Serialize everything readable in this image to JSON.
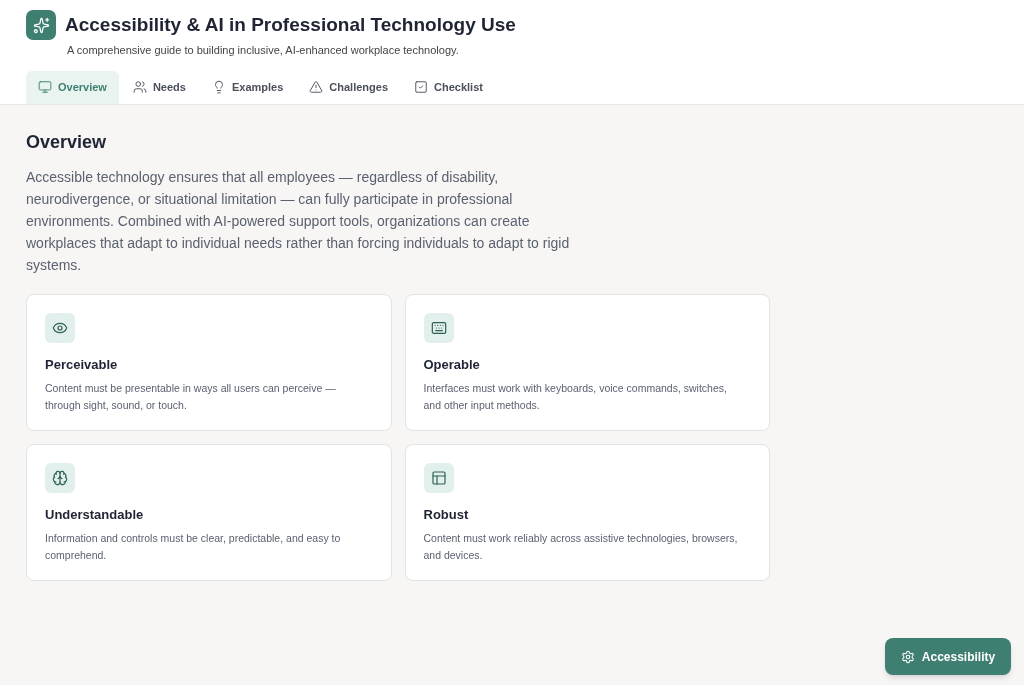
{
  "header": {
    "title": "Accessibility & AI in Professional Technology Use",
    "subtitle": "A comprehensive guide to building inclusive, AI-enhanced workplace technology."
  },
  "tabs": [
    {
      "label": "Overview",
      "selected": true
    },
    {
      "label": "Needs",
      "selected": false
    },
    {
      "label": "Examples",
      "selected": false
    },
    {
      "label": "Challenges",
      "selected": false
    },
    {
      "label": "Checklist",
      "selected": false
    }
  ],
  "section": {
    "heading": "Overview",
    "intro": "Accessible technology ensures that all employees — regardless of disability, neurodivergence, or situational limitation — can fully participate in professional environments. Combined with AI-powered support tools, organizations can create workplaces that adapt to individual needs rather than forcing individuals to adapt to rigid systems."
  },
  "cards": [
    {
      "title": "Perceivable",
      "text": "Content must be presentable in ways all users can perceive — through sight, sound, or touch."
    },
    {
      "title": "Operable",
      "text": "Interfaces must work with keyboards, voice commands, switches, and other input methods."
    },
    {
      "title": "Understandable",
      "text": "Information and controls must be clear, predictable, and easy to comprehend."
    },
    {
      "title": "Robust",
      "text": "Content must work reliably across assistive technologies, browsers, and devices."
    }
  ],
  "accessibility_button": {
    "label": "Accessibility"
  }
}
